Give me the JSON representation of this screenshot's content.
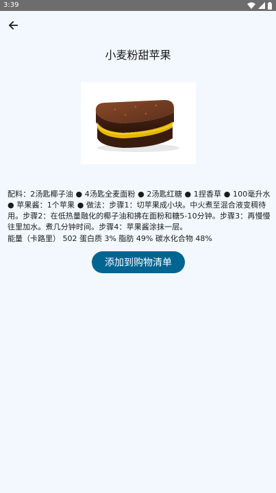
{
  "status_bar": {
    "time": "3:39",
    "icons": [
      "wifi-icon",
      "signal-icon",
      "battery-icon"
    ]
  },
  "header": {
    "back_icon": "arrow-left-icon",
    "title": "小麦粉甜苹果"
  },
  "recipe": {
    "image_icon": "cake-image",
    "description": "配料：2汤匙椰子油 ● 4汤匙全麦面粉 ● 2汤匙红糖 ● 1捏香草 ● 100毫升水 ● 苹果酱：1个苹果 ● 做法：步骤1：切苹果成小块。中火煮至混合液变稠待用。步骤2：在低热量融化的椰子油和拂在面粉和糖5-10分钟。步骤3：再慢慢往里加水。煮几分钟时间。步骤4：苹果酱涂抹一层。",
    "nutrition": "能量（卡路里） 502  蛋白质 3%  脂肪 49%  碳水化合物 48%"
  },
  "actions": {
    "add_to_cart_label": "添加到购物清单"
  },
  "colors": {
    "background": "#f2f8fd",
    "status_bar": "#6d6d6d",
    "button": "#006590",
    "button_text": "#ffffff"
  }
}
